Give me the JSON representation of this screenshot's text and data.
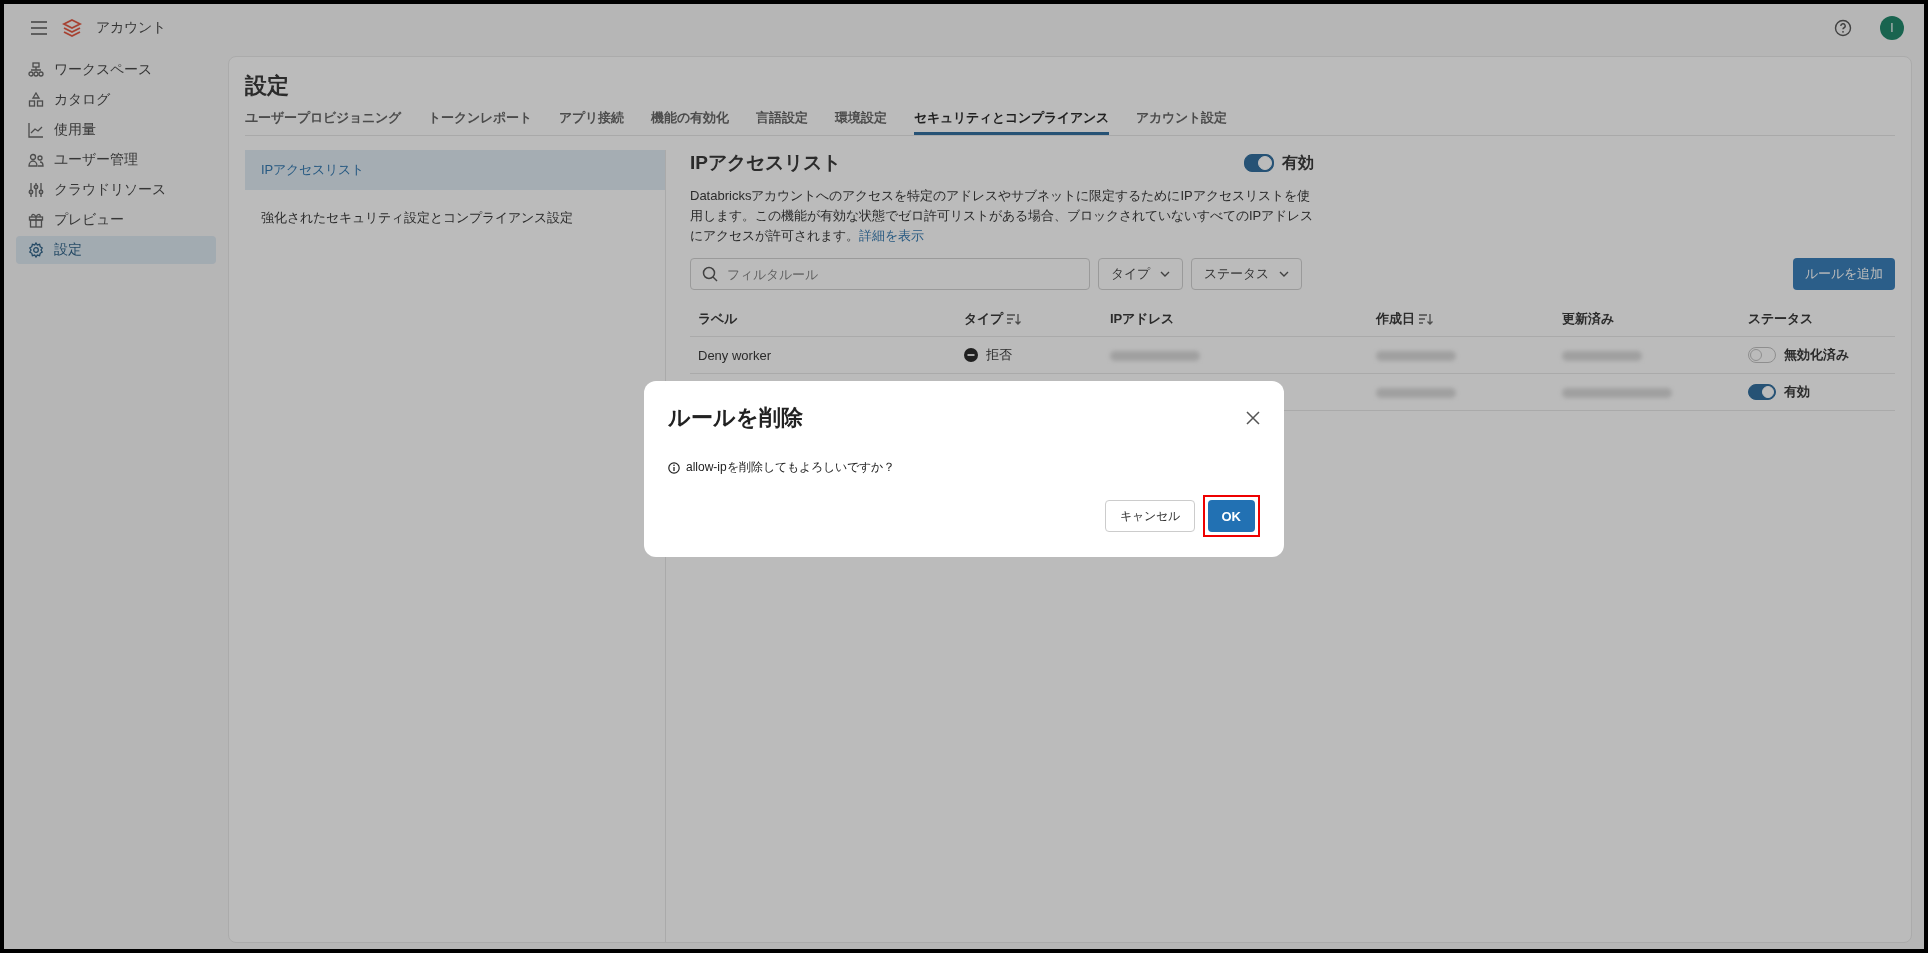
{
  "topbar": {
    "title": "アカウント",
    "avatar": "I"
  },
  "sidebar": {
    "items": [
      {
        "label": "ワークスペース",
        "selected": false
      },
      {
        "label": "カタログ",
        "selected": false
      },
      {
        "label": "使用量",
        "selected": false
      },
      {
        "label": "ユーザー管理",
        "selected": false
      },
      {
        "label": "クラウドリソース",
        "selected": false
      },
      {
        "label": "プレビュー",
        "selected": false
      },
      {
        "label": "設定",
        "selected": true
      }
    ]
  },
  "page_title": "設定",
  "tabs": [
    {
      "label": "ユーザープロビジョニング",
      "selected": false
    },
    {
      "label": "トークンレポート",
      "selected": false
    },
    {
      "label": "アプリ接続",
      "selected": false
    },
    {
      "label": "機能の有効化",
      "selected": false
    },
    {
      "label": "言語設定",
      "selected": false
    },
    {
      "label": "環境設定",
      "selected": false
    },
    {
      "label": "セキュリティとコンプライアンス",
      "selected": true
    },
    {
      "label": "アカウント設定",
      "selected": false
    }
  ],
  "subnav": [
    {
      "label": "IPアクセスリスト",
      "selected": true
    },
    {
      "label": "強化されたセキュリティ設定とコンプライアンス設定",
      "selected": false
    }
  ],
  "section": {
    "title": "IPアクセスリスト",
    "toggle": {
      "on": true,
      "label": "有効"
    },
    "description": "Databricksアカウントへのアクセスを特定のアドレスやサブネットに限定するためにIPアクセスリストを使用します。この機能が有効な状態でゼロ許可リストがある場合、ブロックされていないすべてのIPアドレスにアクセスが許可されます。",
    "link": "詳細を表示"
  },
  "filter": {
    "placeholder": "フィルタルール",
    "dropdowns": [
      "タイプ",
      "ステータス"
    ],
    "add_button": "ルールを追加"
  },
  "table": {
    "columns": [
      {
        "label": "ラベル",
        "sortable": false
      },
      {
        "label": "タイプ",
        "sortable": true
      },
      {
        "label": "IPアドレス",
        "sortable": false
      },
      {
        "label": "作成日",
        "sortable": true
      },
      {
        "label": "更新済み",
        "sortable": false
      },
      {
        "label": "ステータス",
        "sortable": false
      }
    ],
    "rows": [
      {
        "label": "Deny worker",
        "type": "拒否",
        "status": "無効化済み",
        "on": false
      },
      {
        "status": "有効",
        "on": true
      }
    ]
  },
  "dialog": {
    "title": "ルールを削除",
    "message": "allow-ipを削除してもよろしいですか？",
    "cancel": "キャンセル",
    "ok": "OK"
  }
}
